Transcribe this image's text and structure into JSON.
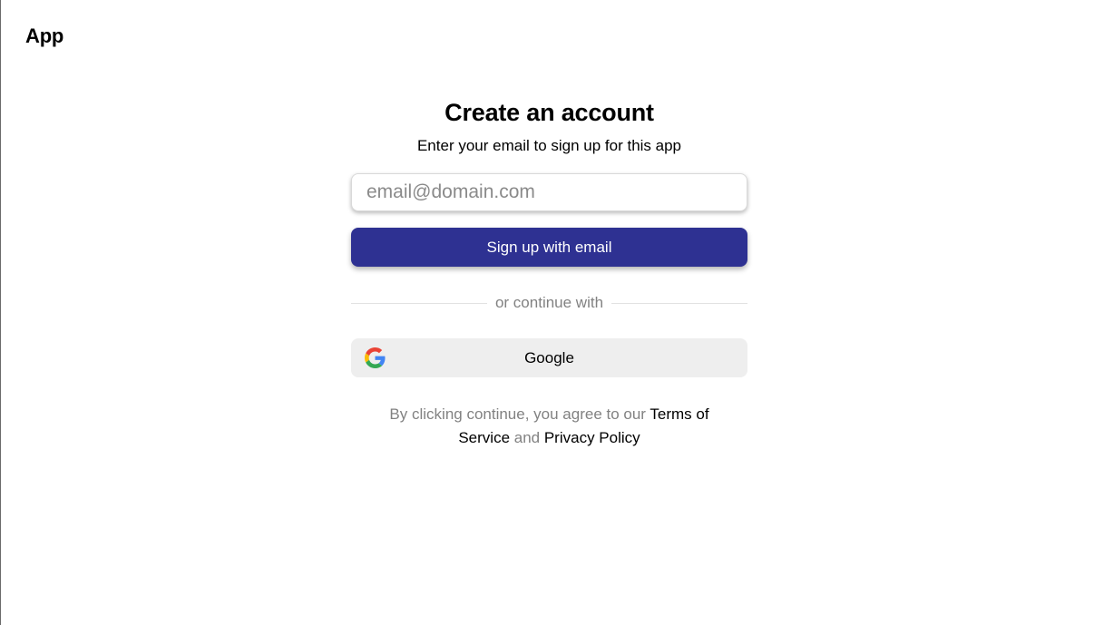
{
  "header": {
    "app_title": "App"
  },
  "signup": {
    "heading": "Create an account",
    "subheading": "Enter your email to sign up for this app",
    "email_placeholder": "email@domain.com",
    "email_value": "",
    "submit_label": "Sign up with email",
    "divider_text": "or continue with",
    "google_label": "Google",
    "google_icon": "google-icon"
  },
  "legal": {
    "prefix": "By clicking continue, you agree to our ",
    "terms_label": "Terms of Service",
    "and_text": " and ",
    "privacy_label": "Privacy Policy"
  },
  "colors": {
    "primary_button": "#2e3192",
    "google_button": "#eeeeee",
    "muted_text": "#828282"
  }
}
